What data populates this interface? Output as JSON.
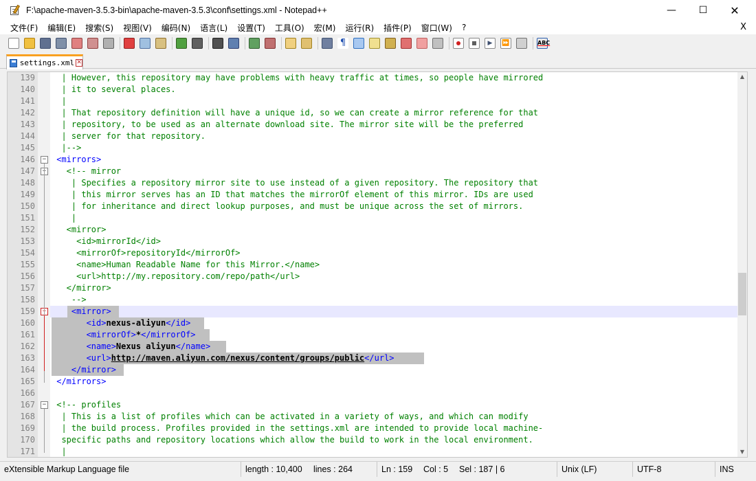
{
  "window": {
    "title": "F:\\apache-maven-3.5.3-bin\\apache-maven-3.5.3\\conf\\settings.xml - Notepad++"
  },
  "menu": [
    "文件(F)",
    "编辑(E)",
    "搜索(S)",
    "视图(V)",
    "编码(N)",
    "语言(L)",
    "设置(T)",
    "工具(O)",
    "宏(M)",
    "运行(R)",
    "插件(P)",
    "窗口(W)",
    "?"
  ],
  "menu_close": "X",
  "tab": {
    "name": "settings.xml"
  },
  "lines": [
    {
      "n": "139",
      "parts": [
        [
          "cmt",
          "  | However, this repository may have problems with heavy traffic at times, so people have mirrored"
        ]
      ]
    },
    {
      "n": "140",
      "parts": [
        [
          "cmt",
          "  | it to several places."
        ]
      ]
    },
    {
      "n": "141",
      "parts": [
        [
          "cmt",
          "  |"
        ]
      ]
    },
    {
      "n": "142",
      "parts": [
        [
          "cmt",
          "  | That repository definition will have a unique id, so we can create a mirror reference for that"
        ]
      ]
    },
    {
      "n": "143",
      "parts": [
        [
          "cmt",
          "  | repository, to be used as an alternate download site. The mirror site will be the preferred"
        ]
      ]
    },
    {
      "n": "144",
      "parts": [
        [
          "cmt",
          "  | server for that repository."
        ]
      ]
    },
    {
      "n": "145",
      "parts": [
        [
          "cmt",
          "  |-->"
        ]
      ]
    },
    {
      "n": "146",
      "parts": [
        [
          "tag",
          " <mirrors>"
        ]
      ]
    },
    {
      "n": "147",
      "parts": [
        [
          "cmt",
          "   <!-- mirror"
        ]
      ]
    },
    {
      "n": "148",
      "parts": [
        [
          "cmt",
          "    | Specifies a repository mirror site to use instead of a given repository. The repository that"
        ]
      ]
    },
    {
      "n": "149",
      "parts": [
        [
          "cmt",
          "    | this mirror serves has an ID that matches the mirrorOf element of this mirror. IDs are used"
        ]
      ]
    },
    {
      "n": "150",
      "parts": [
        [
          "cmt",
          "    | for inheritance and direct lookup purposes, and must be unique across the set of mirrors."
        ]
      ]
    },
    {
      "n": "151",
      "parts": [
        [
          "cmt",
          "    |"
        ]
      ]
    },
    {
      "n": "152",
      "parts": [
        [
          "cmt",
          "   <mirror>"
        ]
      ]
    },
    {
      "n": "153",
      "parts": [
        [
          "cmt",
          "     <id>mirrorId</id>"
        ]
      ]
    },
    {
      "n": "154",
      "parts": [
        [
          "cmt",
          "     <mirrorOf>repositoryId</mirrorOf>"
        ]
      ]
    },
    {
      "n": "155",
      "parts": [
        [
          "cmt",
          "     <name>Human Readable Name for this Mirror.</name>"
        ]
      ]
    },
    {
      "n": "156",
      "parts": [
        [
          "cmt",
          "     <url>http://my.repository.com/repo/path</url>"
        ]
      ]
    },
    {
      "n": "157",
      "parts": [
        [
          "cmt",
          "   </mirror>"
        ]
      ]
    },
    {
      "n": "158",
      "parts": [
        [
          "cmt",
          "    -->"
        ]
      ]
    },
    {
      "n": "159",
      "parts": [
        [
          "tag",
          "    <mirror>"
        ]
      ]
    },
    {
      "n": "160",
      "parts": [
        [
          "tag",
          "       <id>"
        ],
        [
          "bold",
          "nexus-aliyun"
        ],
        [
          "tag",
          "</id>"
        ]
      ]
    },
    {
      "n": "161",
      "parts": [
        [
          "tag",
          "       <mirrorOf>"
        ],
        [
          "bold",
          "*"
        ],
        [
          "tag",
          "</mirrorOf>"
        ]
      ]
    },
    {
      "n": "162",
      "parts": [
        [
          "tag",
          "       <name>"
        ],
        [
          "bold",
          "Nexus aliyun"
        ],
        [
          "tag",
          "</name>"
        ]
      ]
    },
    {
      "n": "163",
      "parts": [
        [
          "tag",
          "       <url>"
        ],
        [
          "boldul",
          "http://maven.aliyun.com/nexus/content/groups/public"
        ],
        [
          "tag",
          "</url>"
        ]
      ]
    },
    {
      "n": "164",
      "parts": [
        [
          "tag",
          "    </mirror>"
        ]
      ]
    },
    {
      "n": "165",
      "parts": [
        [
          "tag",
          " </mirrors>"
        ]
      ]
    },
    {
      "n": "166",
      "parts": [
        [
          "txt",
          ""
        ]
      ]
    },
    {
      "n": "167",
      "parts": [
        [
          "cmt",
          " <!-- profiles"
        ]
      ]
    },
    {
      "n": "168",
      "parts": [
        [
          "cmt",
          "  | This is a list of profiles which can be activated in a variety of ways, and which can modify"
        ]
      ]
    },
    {
      "n": "169",
      "parts": [
        [
          "cmt",
          "  | the build process. Profiles provided in the settings.xml are intended to provide local machine-"
        ]
      ]
    },
    {
      "n": "170",
      "parts": [
        [
          "cmt",
          "  specific paths and repository locations which allow the build to work in the local environment."
        ]
      ]
    },
    {
      "n": "171",
      "parts": [
        [
          "cmt",
          "  |"
        ]
      ]
    }
  ],
  "status": {
    "filetype": "eXtensible Markup Language file",
    "length": "length : 10,400",
    "lines": "lines : 264",
    "ln": "Ln : 159",
    "col": "Col : 5",
    "sel": "Sel : 187 | 6",
    "eol": "Unix (LF)",
    "encoding": "UTF-8",
    "mode": "INS"
  },
  "colors": {
    "comment": "#008000",
    "tag": "#0000ff",
    "tab_accent": "#f9a020",
    "selection": "#c0c0c0"
  }
}
